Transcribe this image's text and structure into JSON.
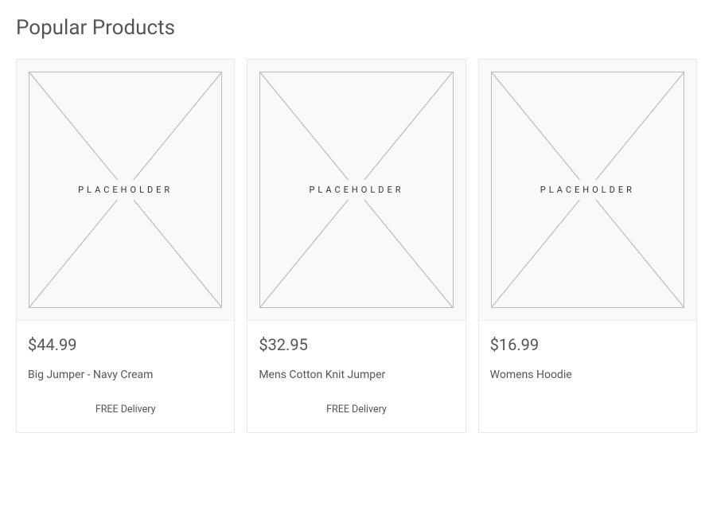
{
  "section": {
    "title": "Popular Products"
  },
  "placeholder_label": "PLACEHOLDER",
  "products": [
    {
      "price": "$44.99",
      "name": "Big Jumper -  Navy Cream",
      "delivery": "FREE Delivery"
    },
    {
      "price": "$32.95",
      "name": "Mens Cotton Knit Jumper",
      "delivery": "FREE Delivery"
    },
    {
      "price": "$16.99",
      "name": "Womens Hoodie",
      "delivery": ""
    }
  ]
}
